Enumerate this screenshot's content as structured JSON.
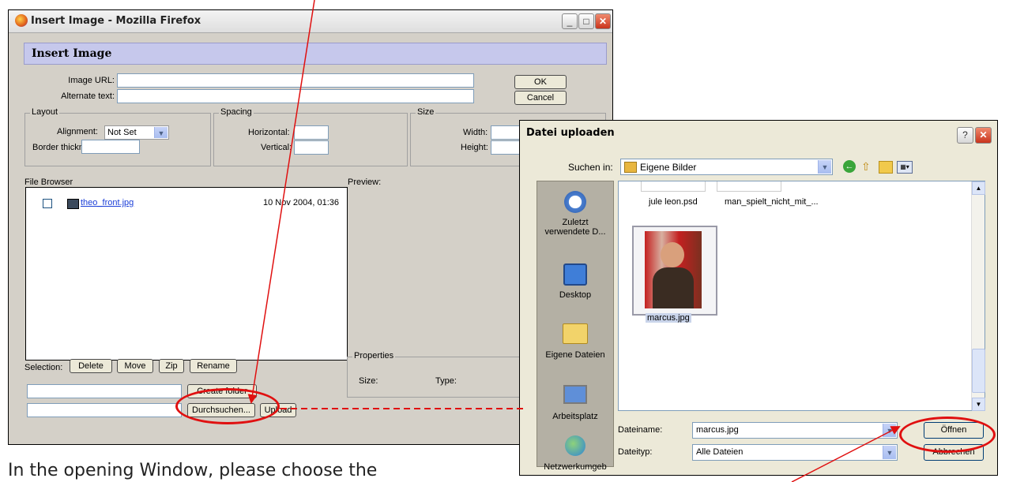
{
  "insert_image_window": {
    "title": "Insert Image - Mozilla Firefox",
    "header": "Insert Image",
    "image_url_label": "Image URL:",
    "alt_text_label": "Alternate text:",
    "ok_label": "OK",
    "cancel_label": "Cancel",
    "layout": {
      "legend": "Layout",
      "alignment_label": "Alignment:",
      "alignment_value": "Not Set",
      "border_label": "Border thickness:"
    },
    "spacing": {
      "legend": "Spacing",
      "horizontal_label": "Horizontal:",
      "vertical_label": "Vertical:"
    },
    "size": {
      "legend": "Size",
      "width_label": "Width:",
      "height_label": "Height:"
    },
    "file_browser_label": "File Browser",
    "preview_label": "Preview:",
    "files": [
      {
        "name": "theo_front.jpg",
        "date": "10 Nov 2004, 01:36"
      }
    ],
    "selection_label": "Selection:",
    "selection_buttons": [
      "Delete",
      "Move",
      "Zip",
      "Rename"
    ],
    "properties": {
      "legend": "Properties",
      "size_label": "Size:",
      "type_label": "Type:"
    },
    "create_folder_label": "Create folder",
    "browse_label": "Durchsuchen...",
    "upload_label": "Upload"
  },
  "upload_dialog": {
    "title": "Datei uploaden",
    "look_in_label": "Suchen in:",
    "look_in_value": "Eigene Bilder",
    "places": [
      {
        "label": "Zuletzt verwendete D...",
        "icon": "recent-icon"
      },
      {
        "label": "Desktop",
        "icon": "desktop-icon"
      },
      {
        "label": "Eigene Dateien",
        "icon": "my-documents-icon"
      },
      {
        "label": "Arbeitsplatz",
        "icon": "my-computer-icon"
      },
      {
        "label": "Netzwerkumgeb",
        "icon": "network-icon"
      }
    ],
    "files": [
      "jule leon.psd",
      "man_spielt_nicht_mit_...",
      "marcus.jpg"
    ],
    "filename_label": "Dateiname:",
    "filename_value": "marcus.jpg",
    "filetype_label": "Dateityp:",
    "filetype_value": "Alle Dateien",
    "open_label": "Öffnen",
    "cancel_label": "Abbrechen"
  },
  "caption": "In the opening Window, please choose the",
  "colors": {
    "annotation": "#e01010",
    "header_bg": "#c6c8ec",
    "dialog_bg": "#ece9d8"
  }
}
